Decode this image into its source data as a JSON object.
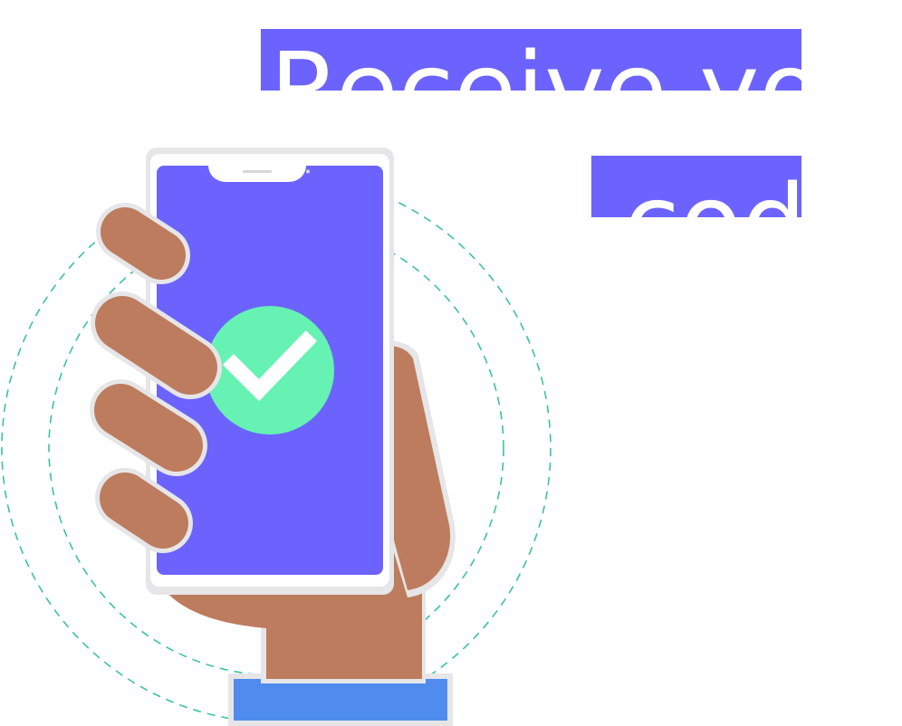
{
  "headline": {
    "line1": "Receive your",
    "line2": "code"
  },
  "colors": {
    "accent": "#6c63ff",
    "check": "#65f2b3",
    "skin": "#bd7c5e",
    "sleeve": "#4f8cee",
    "rings": "#3cc39a",
    "phone_frame": "#ffffff",
    "shadow": "#e8e8ea"
  },
  "icons": {
    "status": "check-icon",
    "device": "smartphone-icon"
  }
}
